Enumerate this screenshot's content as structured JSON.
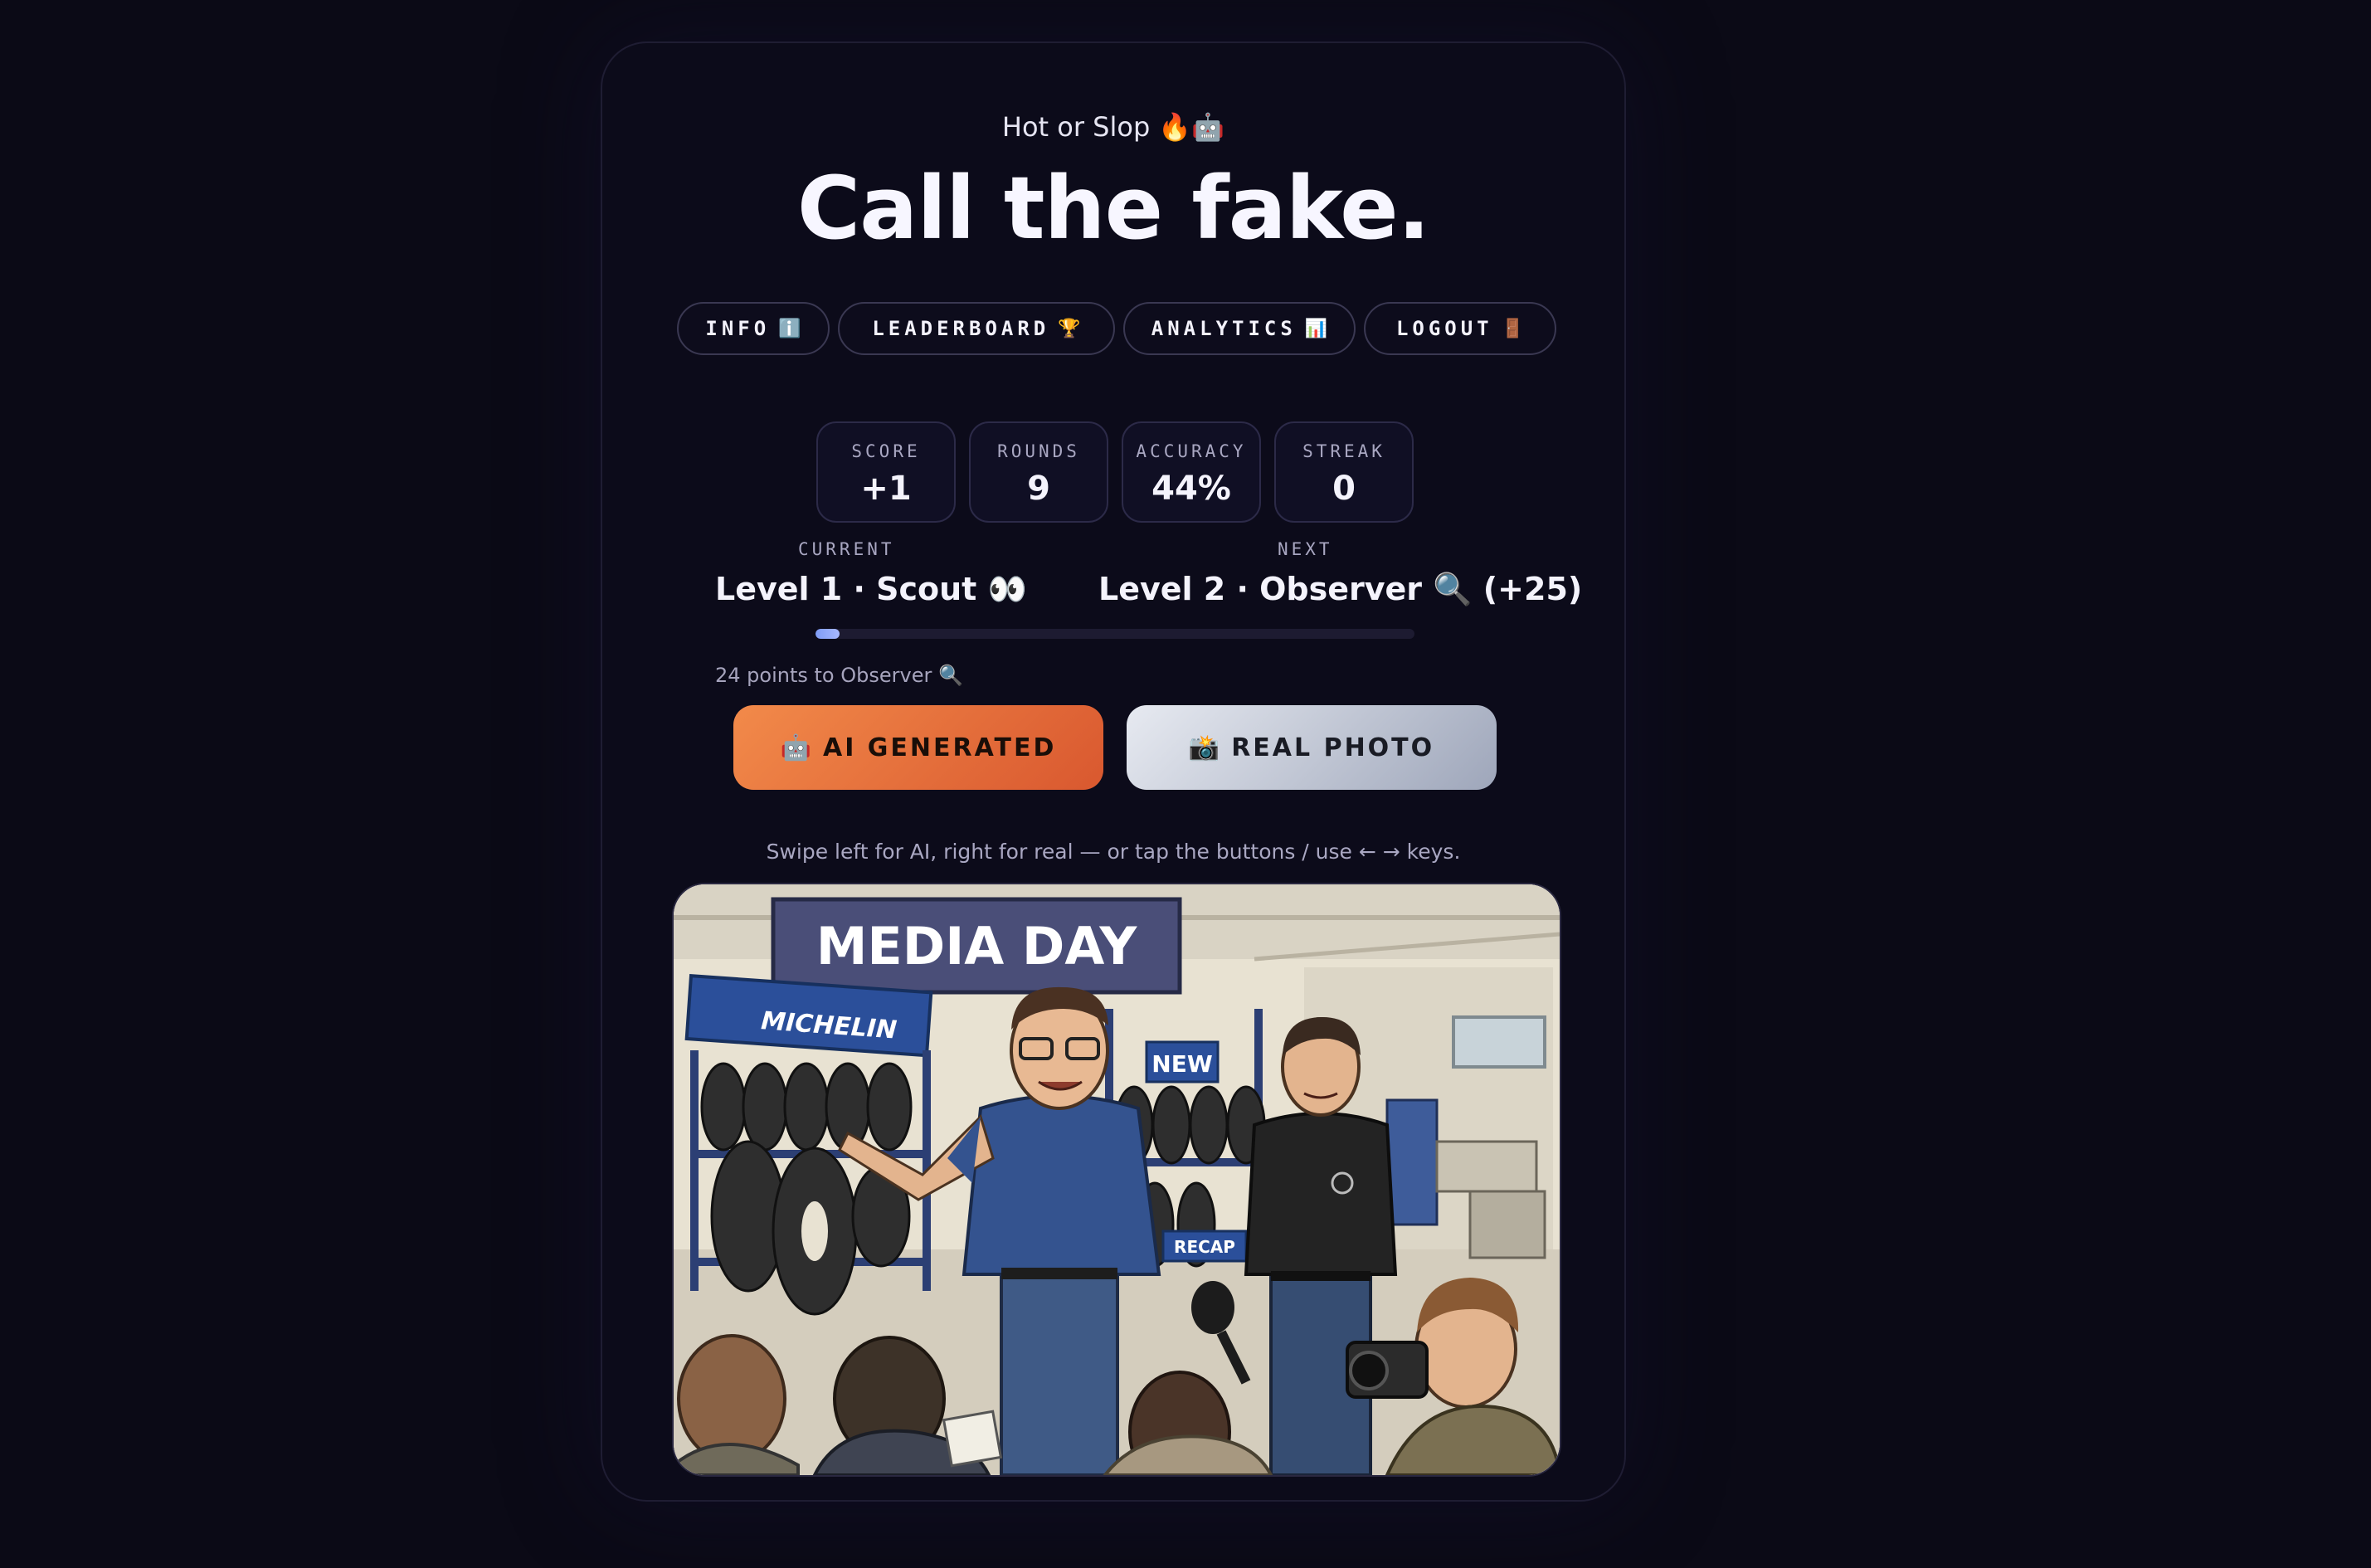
{
  "header": {
    "eyebrow": "Hot or Slop",
    "eyebrow_icons": "🔥🤖",
    "title": "Call the fake."
  },
  "nav": [
    {
      "label": "INFO",
      "icon": "ℹ️",
      "icon_name": "info-icon"
    },
    {
      "label": "LEADERBOARD",
      "icon": "🏆",
      "icon_name": "trophy-icon"
    },
    {
      "label": "ANALYTICS",
      "icon": "📊",
      "icon_name": "bar-chart-icon"
    },
    {
      "label": "LOGOUT",
      "icon": "🚪",
      "icon_name": "door-icon"
    }
  ],
  "stats": [
    {
      "label": "SCORE",
      "value": "+1"
    },
    {
      "label": "ROUNDS",
      "value": "9"
    },
    {
      "label": "ACCURACY",
      "value": "44%"
    },
    {
      "label": "STREAK",
      "value": "0"
    }
  ],
  "level": {
    "current_caption": "CURRENT",
    "current_name": "Level 1 · Scout 👀",
    "next_caption": "NEXT",
    "next_name": "Level 2 · Observer 🔍 (+25)",
    "progress_fraction": 0.04,
    "points_hint": "24 points to Observer 🔍",
    "progress_color": "#8ea6fa"
  },
  "choices": {
    "ai_icon": "🤖",
    "ai_label": "AI GENERATED",
    "ai_color": "#e8743c",
    "real_icon": "📸",
    "real_label": "REAL PHOTO",
    "real_color": "#c9ceda"
  },
  "swipe_hint": "Swipe left for AI, right for real — or tap the buttons / use ← → keys.",
  "photo": {
    "banner": "MEDIA DAY",
    "brand_sign": "MICHELIN",
    "rack_sign": "NEW",
    "rack_label": "RECAP"
  }
}
